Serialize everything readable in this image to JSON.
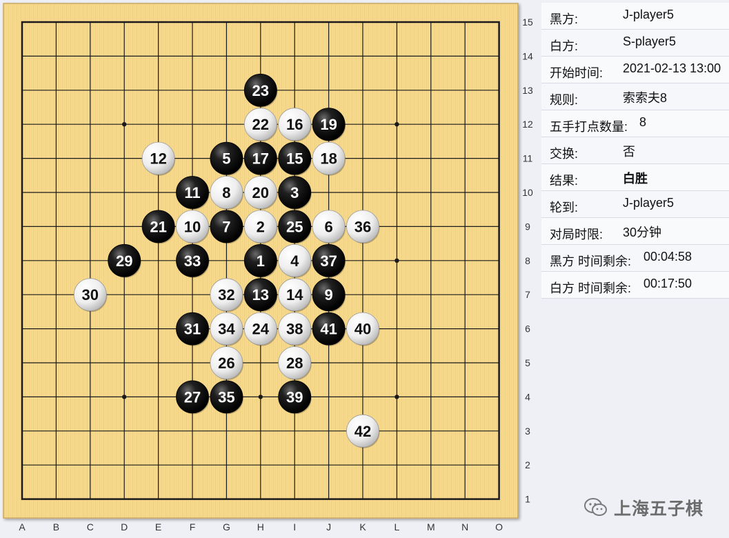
{
  "board": {
    "columns": [
      "A",
      "B",
      "C",
      "D",
      "E",
      "F",
      "G",
      "H",
      "I",
      "J",
      "K",
      "L",
      "M",
      "N",
      "O"
    ],
    "rows": [
      "15",
      "14",
      "13",
      "12",
      "11",
      "10",
      "9",
      "8",
      "7",
      "6",
      "5",
      "4",
      "3",
      "2",
      "1"
    ],
    "star_points": [
      "D12",
      "L12",
      "H8",
      "D4",
      "L4",
      "L8",
      "H4"
    ],
    "colors": {
      "board": "#f7d98c",
      "grain": "#e8c574",
      "line": "#1a1a1a",
      "black_stone": "#111111",
      "white_stone": "#f2f2f2"
    }
  },
  "moves": [
    {
      "n": "1",
      "color": "black",
      "pos": "H8"
    },
    {
      "n": "2",
      "color": "white",
      "pos": "H9"
    },
    {
      "n": "3",
      "color": "black",
      "pos": "I10"
    },
    {
      "n": "4",
      "color": "white",
      "pos": "I8"
    },
    {
      "n": "5",
      "color": "black",
      "pos": "G11"
    },
    {
      "n": "6",
      "color": "white",
      "pos": "J9"
    },
    {
      "n": "7",
      "color": "black",
      "pos": "G9"
    },
    {
      "n": "8",
      "color": "white",
      "pos": "G10"
    },
    {
      "n": "9",
      "color": "black",
      "pos": "J7"
    },
    {
      "n": "10",
      "color": "white",
      "pos": "F9"
    },
    {
      "n": "11",
      "color": "black",
      "pos": "F10"
    },
    {
      "n": "12",
      "color": "white",
      "pos": "E11"
    },
    {
      "n": "13",
      "color": "black",
      "pos": "H7"
    },
    {
      "n": "14",
      "color": "white",
      "pos": "I7"
    },
    {
      "n": "15",
      "color": "black",
      "pos": "I11"
    },
    {
      "n": "16",
      "color": "white",
      "pos": "I12"
    },
    {
      "n": "17",
      "color": "black",
      "pos": "H11"
    },
    {
      "n": "18",
      "color": "white",
      "pos": "J11"
    },
    {
      "n": "19",
      "color": "black",
      "pos": "J12"
    },
    {
      "n": "20",
      "color": "white",
      "pos": "H10"
    },
    {
      "n": "21",
      "color": "black",
      "pos": "E9"
    },
    {
      "n": "22",
      "color": "white",
      "pos": "H12"
    },
    {
      "n": "23",
      "color": "black",
      "pos": "H13"
    },
    {
      "n": "24",
      "color": "white",
      "pos": "H6"
    },
    {
      "n": "25",
      "color": "black",
      "pos": "I9"
    },
    {
      "n": "26",
      "color": "white",
      "pos": "G5"
    },
    {
      "n": "27",
      "color": "black",
      "pos": "F4"
    },
    {
      "n": "28",
      "color": "white",
      "pos": "I5"
    },
    {
      "n": "29",
      "color": "black",
      "pos": "D8"
    },
    {
      "n": "30",
      "color": "white",
      "pos": "C7"
    },
    {
      "n": "31",
      "color": "black",
      "pos": "F6"
    },
    {
      "n": "32",
      "color": "white",
      "pos": "G7"
    },
    {
      "n": "33",
      "color": "black",
      "pos": "F8"
    },
    {
      "n": "34",
      "color": "white",
      "pos": "G6"
    },
    {
      "n": "35",
      "color": "black",
      "pos": "G4"
    },
    {
      "n": "36",
      "color": "white",
      "pos": "K9"
    },
    {
      "n": "37",
      "color": "black",
      "pos": "J8"
    },
    {
      "n": "38",
      "color": "white",
      "pos": "I6"
    },
    {
      "n": "39",
      "color": "black",
      "pos": "I4"
    },
    {
      "n": "40",
      "color": "white",
      "pos": "K6"
    },
    {
      "n": "41",
      "color": "black",
      "pos": "J6"
    },
    {
      "n": "42",
      "color": "white",
      "pos": "K3"
    }
  ],
  "info": {
    "black_label": "黑方:",
    "black_value": "J-player5",
    "white_label": "白方:",
    "white_value": "S-player5",
    "start_label": "开始时间:",
    "start_value": "2021-02-13 13:00",
    "rule_label": "规则:",
    "rule_value": "索索夫8",
    "fifth_label": "五手打点数量:",
    "fifth_value": "8",
    "swap_label": "交换:",
    "swap_value": "否",
    "result_label": "结果:",
    "result_value": "白胜",
    "turn_label": "轮到:",
    "turn_value": "J-player5",
    "limit_label": "对局时限:",
    "limit_value": "30分钟",
    "black_time_label": "黑方 时间剩余:",
    "black_time_value": "00:04:58",
    "white_time_label": "白方 时间剩余:",
    "white_time_value": "00:17:50"
  },
  "watermark": {
    "text": "上海五子棋",
    "icon": "wechat-icon"
  }
}
